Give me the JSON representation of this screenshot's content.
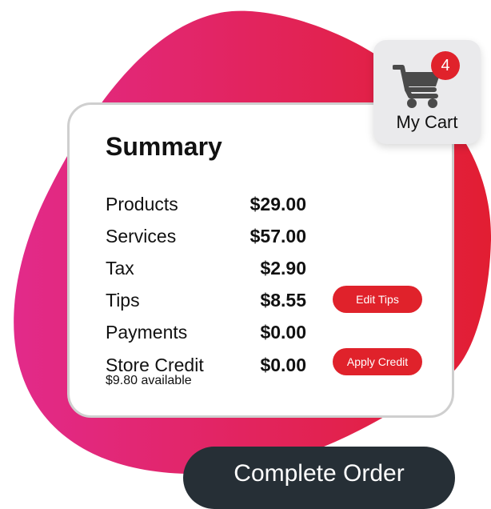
{
  "colors": {
    "blob_left": "#e22a8a",
    "blob_right": "#e21e32",
    "accent": "#e0222b",
    "button_dark": "#262f36"
  },
  "cart": {
    "icon": "cart-icon",
    "badge_count": "4",
    "label": "My Cart"
  },
  "summary": {
    "title": "Summary",
    "rows": [
      {
        "label": "Products",
        "value": "$29.00"
      },
      {
        "label": "Services",
        "value": "$57.00"
      },
      {
        "label": "Tax",
        "value": "$2.90"
      },
      {
        "label": "Tips",
        "value": "$8.55",
        "action": "Edit Tips"
      },
      {
        "label": "Payments",
        "value": "$0.00"
      },
      {
        "label": "Store Credit",
        "value": "$0.00",
        "sublabel": "$9.80 available",
        "action": "Apply Credit"
      }
    ]
  },
  "complete_order": {
    "label": "Complete Order"
  }
}
